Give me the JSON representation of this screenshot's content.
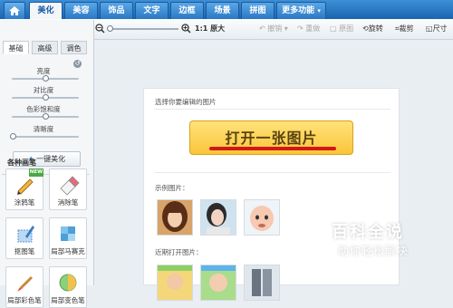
{
  "topbar": {
    "tabs": [
      {
        "label": "美化",
        "active": true
      },
      {
        "label": "美容",
        "active": false
      },
      {
        "label": "饰品",
        "active": false
      },
      {
        "label": "文字",
        "active": false
      },
      {
        "label": "边框",
        "active": false
      },
      {
        "label": "场景",
        "active": false
      },
      {
        "label": "拼图",
        "active": false
      }
    ],
    "more_label": "更多功能"
  },
  "toolbar": {
    "zoom_label": "1:1 原大",
    "undo_label": "撤销",
    "redo_label": "重做",
    "original_label": "原图",
    "rotate_label": "旋转",
    "crop_label": "裁剪",
    "size_label": "尺寸"
  },
  "leftpanel": {
    "subtabs": [
      {
        "label": "基础",
        "active": true
      },
      {
        "label": "高级",
        "active": false
      },
      {
        "label": "调色",
        "active": false
      }
    ],
    "sliders": [
      {
        "label": "亮度",
        "value": 0.5
      },
      {
        "label": "对比度",
        "value": 0.5
      },
      {
        "label": "色彩饱和度",
        "value": 0.5
      },
      {
        "label": "清晰度",
        "value": 0.0
      }
    ],
    "auto_button": "一键美化",
    "brush_section": "各种画笔",
    "new_badge": "NEW",
    "tools": [
      {
        "label": "涂鸦笔",
        "icon": "pencil-icon"
      },
      {
        "label": "消除笔",
        "icon": "eraser-icon"
      },
      {
        "label": "抠图笔",
        "icon": "cutout-pen-icon"
      },
      {
        "label": "局部马赛克",
        "icon": "mosaic-icon"
      },
      {
        "label": "局部彩色笔",
        "icon": "color-brush-icon"
      },
      {
        "label": "局部变色笔",
        "icon": "color-change-icon"
      }
    ]
  },
  "main": {
    "select_prompt": "选择你要编辑的图片",
    "open_button": "打开一张图片",
    "examples_label": "示例图片：",
    "recent_label": "近期打开图片："
  },
  "watermark": {
    "title": "百科全说",
    "subtitle": "助你轻松解决"
  },
  "colors": {
    "accent": "#1b64b0",
    "open_button": "#fbc53a",
    "underline": "#d01818"
  }
}
